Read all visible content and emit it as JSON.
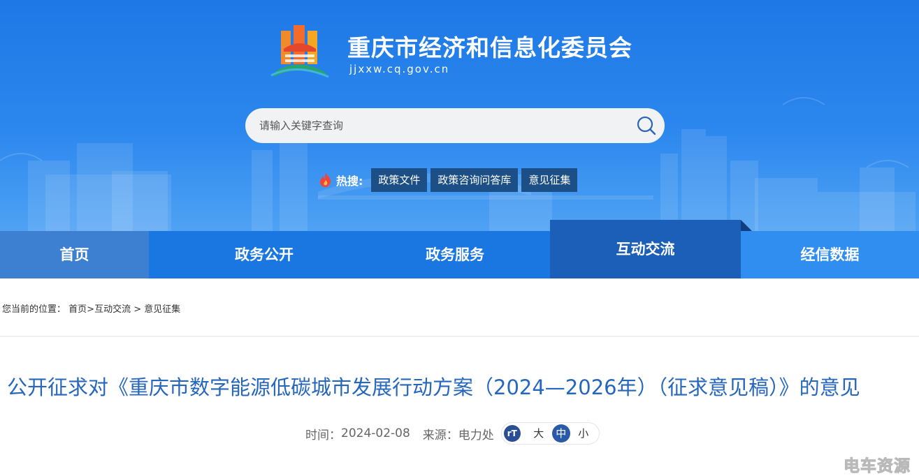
{
  "header": {
    "site_title": "重庆市经济和信息化委员会",
    "site_domain": "jjxxw.cq.gov.cn",
    "search_placeholder": "请输入关键字查询"
  },
  "hot_search": {
    "label": "热搜:",
    "tags": [
      "政策文件",
      "政策咨询问答库",
      "意见征集"
    ]
  },
  "nav": {
    "items": [
      "首页",
      "政务公开",
      "政务服务",
      "互动交流",
      "经信数据"
    ],
    "active": "互动交流"
  },
  "breadcrumb": {
    "prefix": "您当前的位置：",
    "items": [
      "首页",
      "互动交流",
      "意见征集"
    ],
    "sep1": ">",
    "sep2": " > "
  },
  "article": {
    "title": "公开征求对《重庆市数字能源低碳城市发展行动方案（2024—2026年）（征求意见稿）》的意见",
    "time_label": "时间：",
    "time": "2024-02-08",
    "source_label": "来源：",
    "source": "电力处",
    "font_size": {
      "icon": "rT",
      "options": [
        "大",
        "中",
        "小"
      ],
      "selected": "中"
    }
  },
  "watermark": "电车资源",
  "colors": {
    "header_blue": "#1e78e6",
    "nav_blue": "#1a77e2",
    "nav_active": "#1c5fb8",
    "title_blue": "#2667bd",
    "hot_tag_bg": "#1c4f86"
  }
}
